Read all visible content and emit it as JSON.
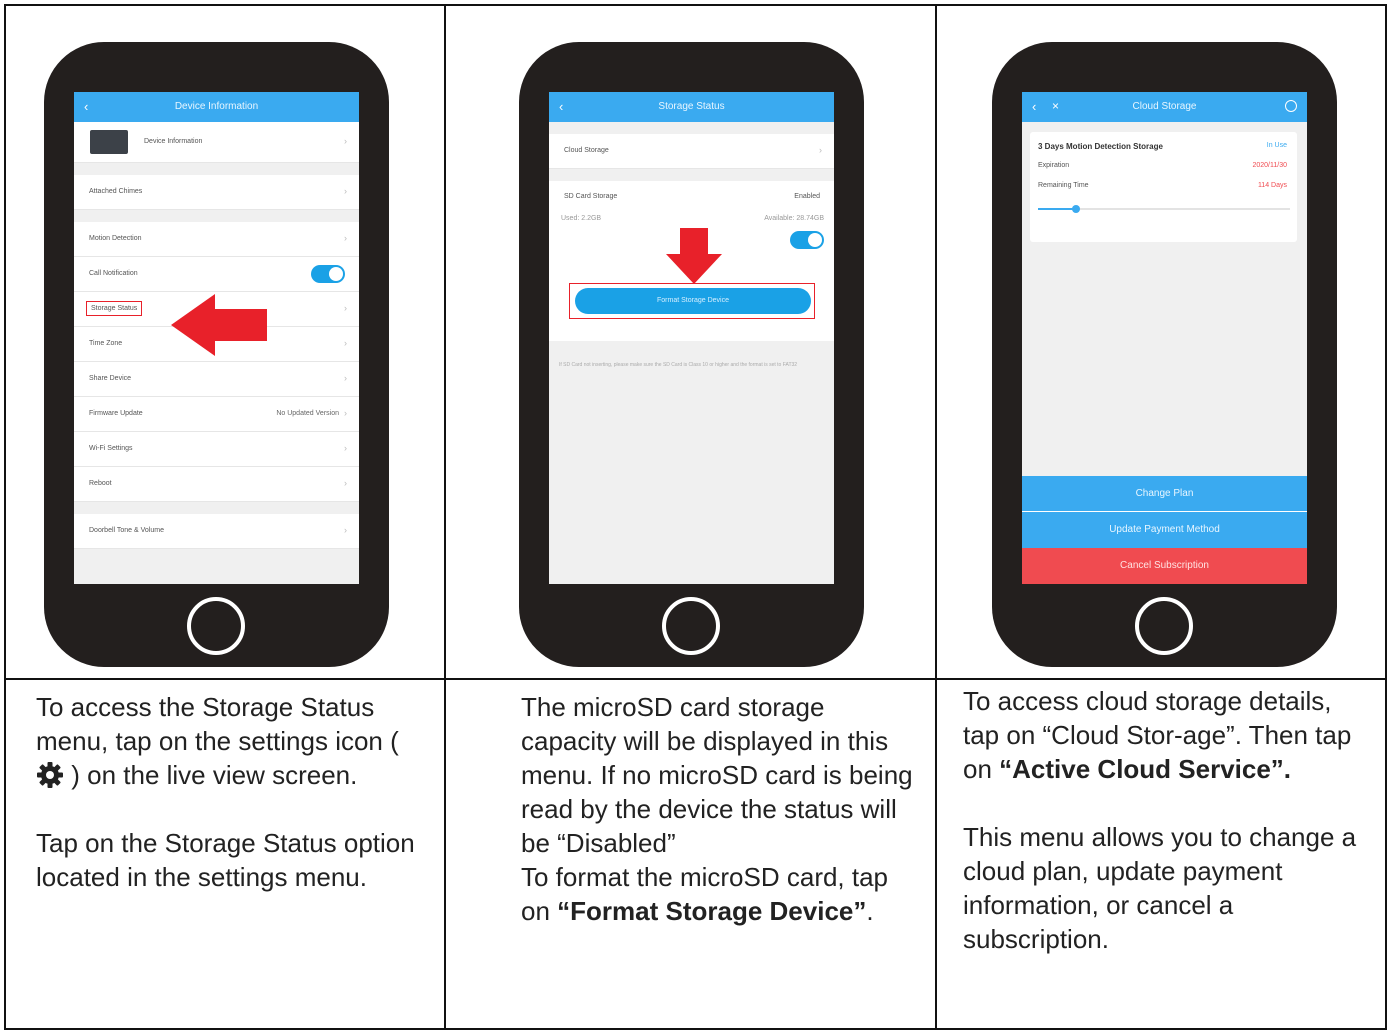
{
  "panel1": {
    "screen": {
      "title": "Device Information",
      "rows": {
        "device_info": "Device Information",
        "attached_chimes": "Attached Chimes",
        "motion_detection": "Motion Detection",
        "call_notification": "Call Notification",
        "storage_status": "Storage Status",
        "time_zone": "Time Zone",
        "share_device": "Share Device",
        "firmware_update": "Firmware Update",
        "firmware_value": "No Updated Version",
        "wifi_settings": "Wi-Fi Settings",
        "reboot": "Reboot",
        "doorbell_tone": "Doorbell Tone & Volume"
      }
    },
    "caption": {
      "p1_before": "To access the Storage Status menu, tap on the settings icon (",
      "p1_after": ") on the live view screen.",
      "p2": "Tap on the Storage Status option located in the settings menu."
    }
  },
  "panel2": {
    "screen": {
      "title": "Storage Status",
      "cloud_storage": "Cloud Storage",
      "sd_card_storage": "SD Card Storage",
      "sd_status": "Enabled",
      "used": "Used: 2.2GB",
      "available": "Available: 28.74GB",
      "format_button": "Format Storage Device",
      "note": "If SD Card not inserting, please make sure the SD Card is Class 10 or higher and the format is set to FAT32"
    },
    "caption": {
      "line_a": "The microSD card storage capacity will be displayed in this menu. If no microSD card is being read by the device the status will be “Disabled”",
      "line_b_before": "To format the microSD card, tap on ",
      "line_b_bold": "“Format Storage Device”",
      "line_b_after": "."
    }
  },
  "panel3": {
    "screen": {
      "title": "Cloud Storage",
      "plan_name": "3 Days Motion Detection Storage",
      "plan_status": "In Use",
      "expiration_label": "Expiration",
      "expiration_value": "2020/11/30",
      "remaining_label": "Remaining Time",
      "remaining_value": "114 Days",
      "remaining_fraction": 0.15,
      "change_plan": "Change Plan",
      "update_payment": "Update Payment Method",
      "cancel_subscription": "Cancel Subscription"
    },
    "caption": {
      "p1_before": "To access cloud storage details, tap on “Cloud Stor-age”. Then tap on ",
      "p1_bold": "“Active Cloud Service”.",
      "p2": "This menu allows you to change a cloud plan, update payment information, or cancel a subscription."
    }
  },
  "colors": {
    "app_blue": "#3aaaf0",
    "button_blue": "#1aa1e6",
    "arrow_red": "#e8212a",
    "cancel_red": "#f04b50",
    "phone_body": "#231f1e"
  }
}
